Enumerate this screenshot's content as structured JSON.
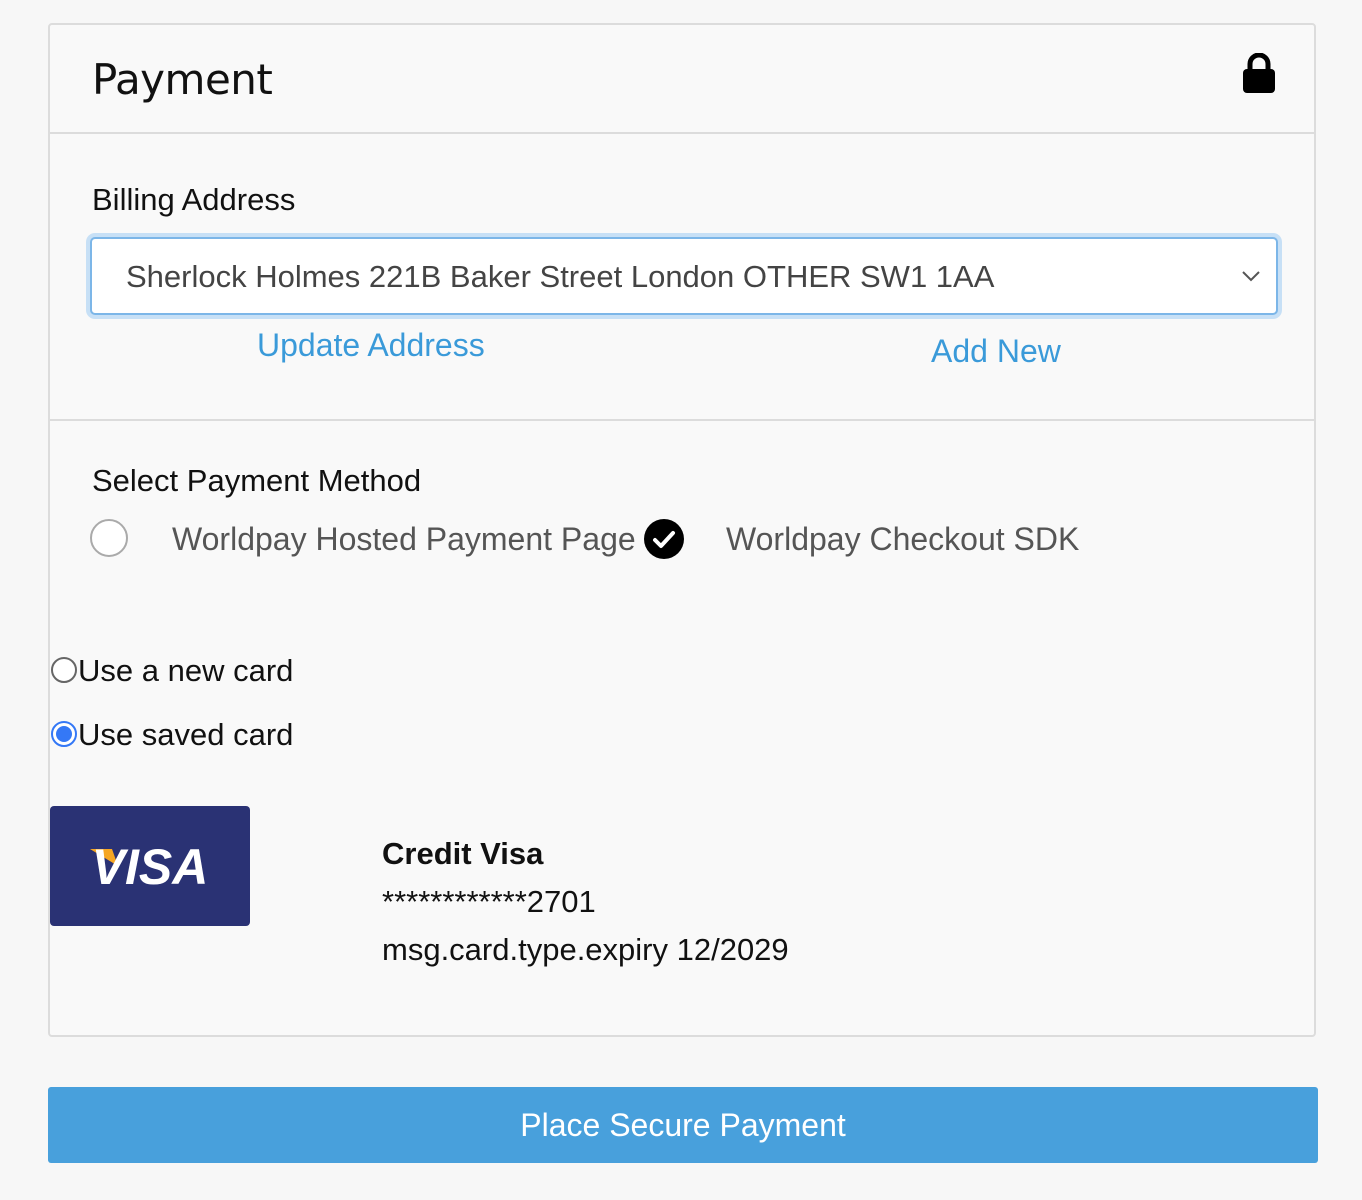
{
  "header": {
    "title": "Payment"
  },
  "billing": {
    "label": "Billing Address",
    "selected_address": "Sherlock Holmes 221B Baker Street London OTHER SW1 1AA",
    "update_link": "Update Address",
    "add_link": "Add New"
  },
  "payment_method": {
    "label": "Select Payment Method",
    "options": [
      {
        "label": "Worldpay Hosted Payment Page",
        "selected": false
      },
      {
        "label": "Worldpay Checkout SDK",
        "selected": true
      }
    ]
  },
  "card_choice": {
    "new_card": "Use a new card",
    "saved_card": "Use saved card",
    "selected": "saved_card"
  },
  "saved_card": {
    "brand_logo": "VISA",
    "type": "Credit Visa",
    "masked_number": "************2701",
    "expiry": "msg.card.type.expiry 12/2029"
  },
  "submit": {
    "label": "Place Secure Payment"
  },
  "colors": {
    "accent": "#48a0dc",
    "link": "#3a9ad9",
    "visa_blue": "#2a3274",
    "visa_gold": "#f5a623"
  },
  "icons": {
    "lock": "lock-icon",
    "chevron": "chevron-down-icon",
    "check": "check-circle-icon"
  }
}
